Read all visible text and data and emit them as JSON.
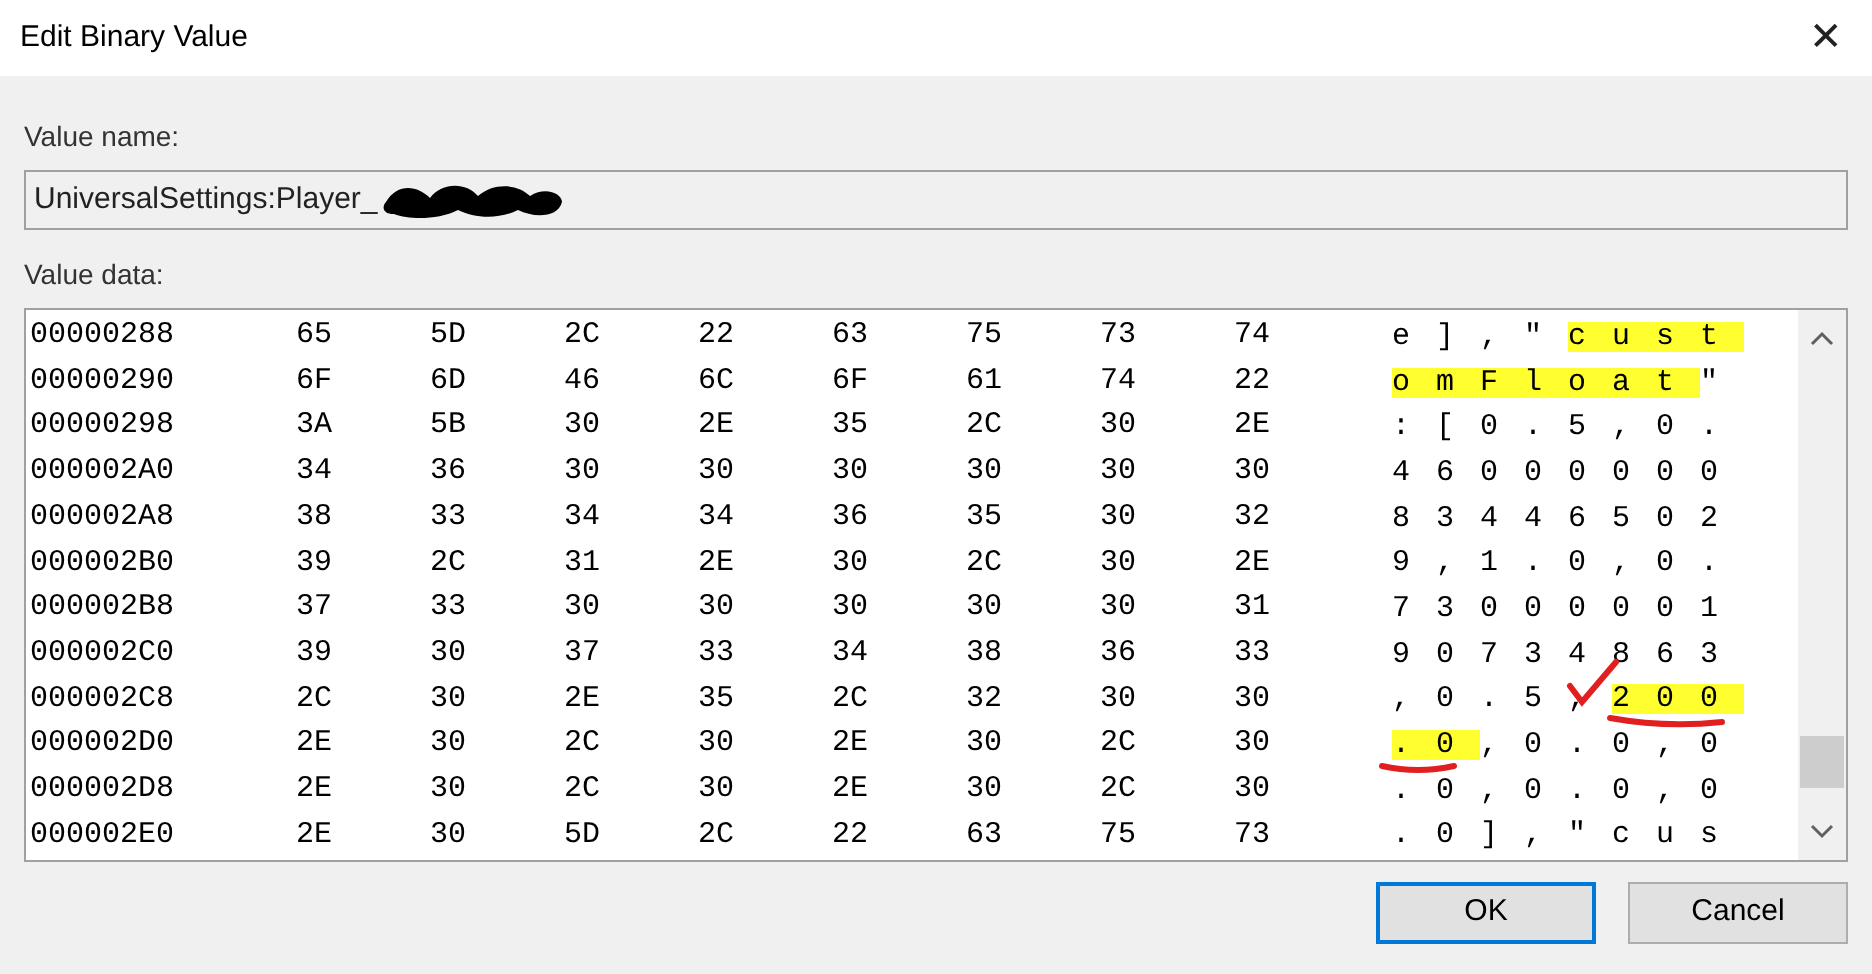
{
  "window": {
    "title": "Edit Binary Value",
    "close": "✕"
  },
  "value_name": {
    "label": "Value name:",
    "value": "UniversalSettings:Player_"
  },
  "value_data": {
    "label": "Value data:",
    "rows": [
      {
        "address": "00000288",
        "bytes": [
          "65",
          "5D",
          "2C",
          "22",
          "63",
          "75",
          "73",
          "74"
        ],
        "ascii": [
          {
            "text": "e],\"",
            "highlighted": false
          },
          {
            "text": "cust",
            "highlighted": true
          }
        ]
      },
      {
        "address": "00000290",
        "bytes": [
          "6F",
          "6D",
          "46",
          "6C",
          "6F",
          "61",
          "74",
          "22"
        ],
        "ascii": [
          {
            "text": "omFloat",
            "highlighted": true
          },
          {
            "text": "\"",
            "highlighted": false
          }
        ]
      },
      {
        "address": "00000298",
        "bytes": [
          "3A",
          "5B",
          "30",
          "2E",
          "35",
          "2C",
          "30",
          "2E"
        ],
        "ascii": [
          {
            "text": ":[0.5,0.",
            "highlighted": false
          }
        ]
      },
      {
        "address": "000002A0",
        "bytes": [
          "34",
          "36",
          "30",
          "30",
          "30",
          "30",
          "30",
          "30"
        ],
        "ascii": [
          {
            "text": "46000000",
            "highlighted": false
          }
        ]
      },
      {
        "address": "000002A8",
        "bytes": [
          "38",
          "33",
          "34",
          "34",
          "36",
          "35",
          "30",
          "32"
        ],
        "ascii": [
          {
            "text": "83446502",
            "highlighted": false
          }
        ]
      },
      {
        "address": "000002B0",
        "bytes": [
          "39",
          "2C",
          "31",
          "2E",
          "30",
          "2C",
          "30",
          "2E"
        ],
        "ascii": [
          {
            "text": "9,1.0,0.",
            "highlighted": false
          }
        ]
      },
      {
        "address": "000002B8",
        "bytes": [
          "37",
          "33",
          "30",
          "30",
          "30",
          "30",
          "30",
          "31"
        ],
        "ascii": [
          {
            "text": "73000001",
            "highlighted": false
          }
        ]
      },
      {
        "address": "000002C0",
        "bytes": [
          "39",
          "30",
          "37",
          "33",
          "34",
          "38",
          "36",
          "33"
        ],
        "ascii": [
          {
            "text": "90734863",
            "highlighted": false
          }
        ]
      },
      {
        "address": "000002C8",
        "bytes": [
          "2C",
          "30",
          "2E",
          "35",
          "2C",
          "32",
          "30",
          "30"
        ],
        "ascii": [
          {
            "text": ",0.5,",
            "highlighted": false
          },
          {
            "text": "200",
            "highlighted": true
          }
        ]
      },
      {
        "address": "000002D0",
        "bytes": [
          "2E",
          "30",
          "2C",
          "30",
          "2E",
          "30",
          "2C",
          "30"
        ],
        "ascii": [
          {
            "text": ".0",
            "highlighted": true
          },
          {
            "text": ",0.0,0",
            "highlighted": false
          }
        ]
      },
      {
        "address": "000002D8",
        "bytes": [
          "2E",
          "30",
          "2C",
          "30",
          "2E",
          "30",
          "2C",
          "30"
        ],
        "ascii": [
          {
            "text": ".0,0.0,0",
            "highlighted": false
          }
        ]
      },
      {
        "address": "000002E0",
        "bytes": [
          "2E",
          "30",
          "5D",
          "2C",
          "22",
          "63",
          "75",
          "73"
        ],
        "ascii": [
          {
            "text": ".0],\"cus",
            "highlighted": false
          }
        ]
      }
    ]
  },
  "buttons": [
    {
      "label": "OK",
      "default": true
    },
    {
      "label": "Cancel",
      "default": false
    }
  ]
}
